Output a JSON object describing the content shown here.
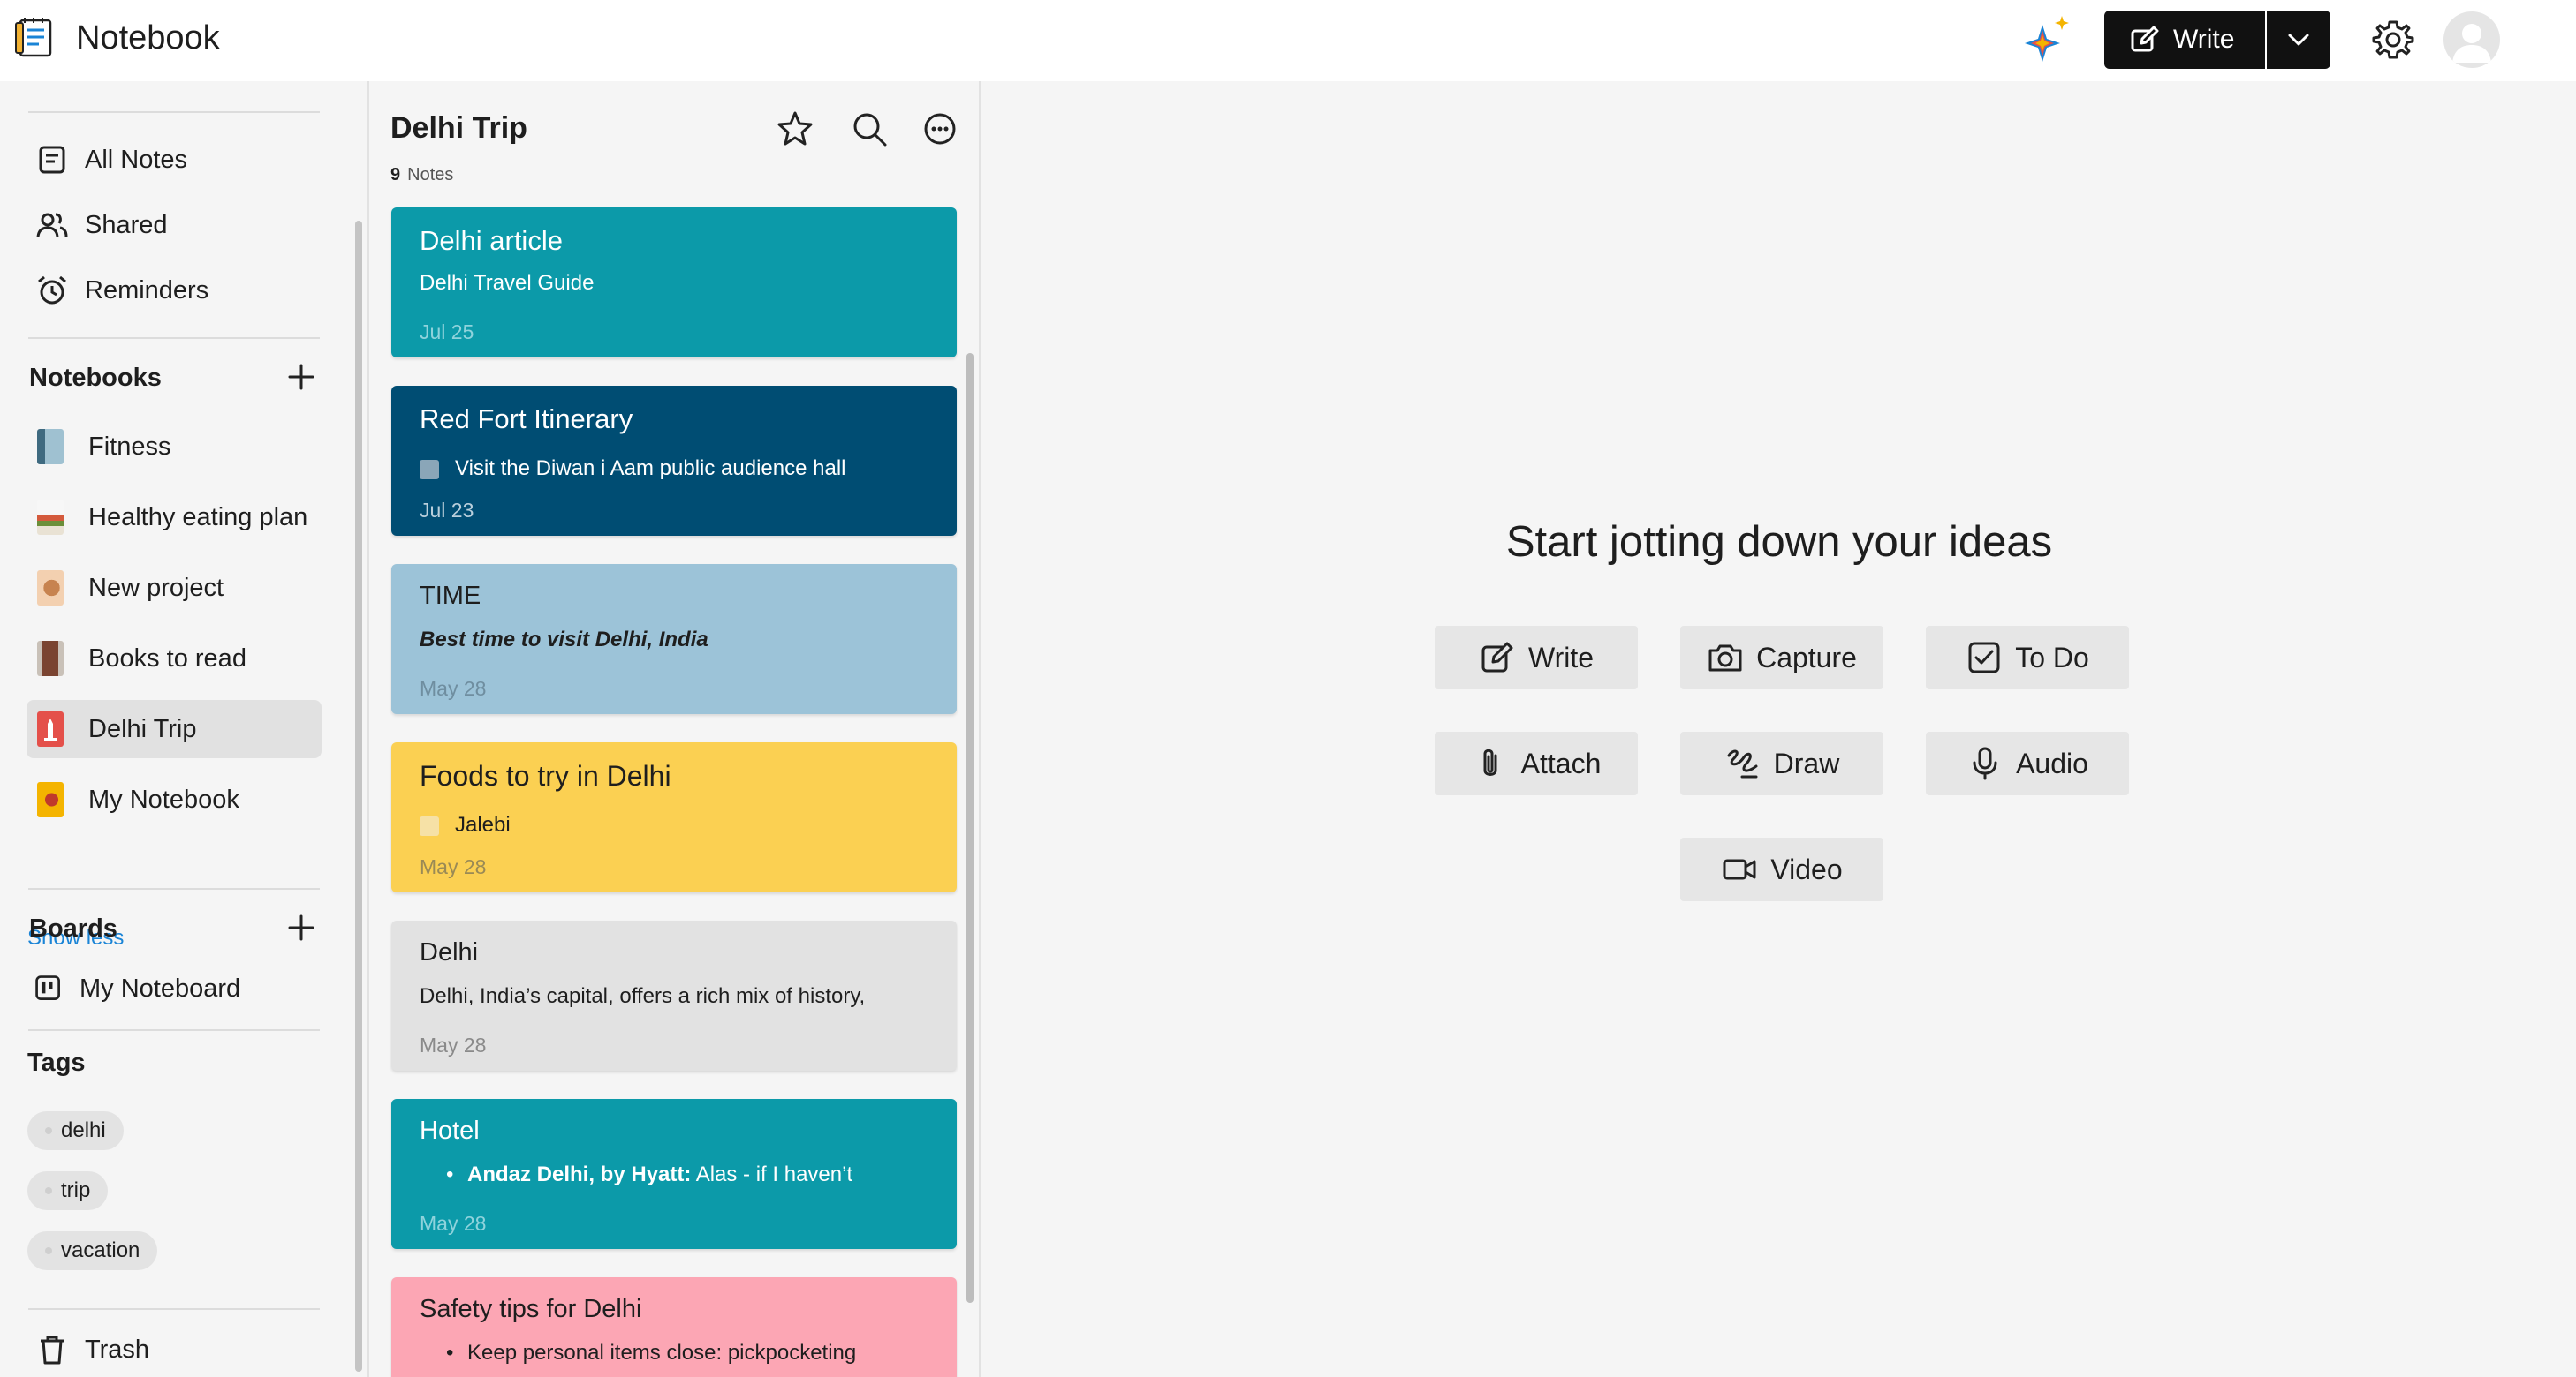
{
  "header": {
    "title": "Notebook",
    "write_label": "Write"
  },
  "sidebar": {
    "nav": [
      {
        "label": "All Notes",
        "icon": "note-icon"
      },
      {
        "label": "Shared",
        "icon": "people-icon"
      },
      {
        "label": "Reminders",
        "icon": "alarm-clock-icon"
      }
    ],
    "notebooks_title": "Notebooks",
    "notebooks": [
      {
        "label": "Fitness",
        "cover_color": "#6c8fa0"
      },
      {
        "label": "Healthy eating plan",
        "cover_color": "#c9d6de"
      },
      {
        "label": "New project",
        "cover_color": "#e8b08a"
      },
      {
        "label": "Books to read",
        "cover_color": "#8a5a44"
      },
      {
        "label": "Delhi Trip",
        "cover_color": "#e4504a",
        "active": true
      },
      {
        "label": "My Notebook",
        "cover_color": "#f4b400"
      }
    ],
    "show_less": "Show less",
    "boards_title": "Boards",
    "boards": [
      {
        "label": "My Noteboard"
      }
    ],
    "tags_title": "Tags",
    "tags": [
      "delhi",
      "trip",
      "vacation"
    ],
    "trash": "Trash"
  },
  "notes_panel": {
    "title": "Delhi Trip",
    "count": "9",
    "count_label": "Notes",
    "notes": [
      {
        "title": "Delhi article",
        "subtitle": "Delhi Travel Guide",
        "date": "Jul 25",
        "color": "#0c9aa9"
      },
      {
        "title": "Red Fort Itinerary",
        "checkbox_text": "Visit the Diwan i Aam public audience hall",
        "date": "Jul 23",
        "color": "#004d73"
      },
      {
        "title": "TIME",
        "subtitle": "Best time to visit Delhi, India",
        "date": "May 28",
        "color": "#9cc3d8"
      },
      {
        "title": "Foods to try in Delhi",
        "checkbox_text": "Jalebi",
        "date": "May 28",
        "color": "#fbd052"
      },
      {
        "title": "Delhi",
        "subtitle": "Delhi, India’s capital, offers a rich mix of history,",
        "date": "May 28",
        "color": "#e2e2e2"
      },
      {
        "title": "Hotel",
        "bullet_bold": "Andaz Delhi, by Hyatt:",
        "bullet_rest": " Alas - if I haven’t",
        "date": "May 28",
        "color": "#0c9aa9"
      },
      {
        "title": "Safety tips for Delhi",
        "bullet_rest": "Keep personal items close: pickpocketing",
        "color": "#fca6b4"
      }
    ]
  },
  "main": {
    "heading": "Start jotting down your ideas",
    "actions": [
      {
        "label": "Write",
        "icon": "pencil-icon"
      },
      {
        "label": "Capture",
        "icon": "camera-icon"
      },
      {
        "label": "To Do",
        "icon": "checkbox-icon"
      },
      {
        "label": "Attach",
        "icon": "paperclip-icon"
      },
      {
        "label": "Draw",
        "icon": "scribble-icon"
      },
      {
        "label": "Audio",
        "icon": "microphone-icon"
      },
      {
        "label": "Video",
        "icon": "video-camera-icon"
      }
    ]
  }
}
